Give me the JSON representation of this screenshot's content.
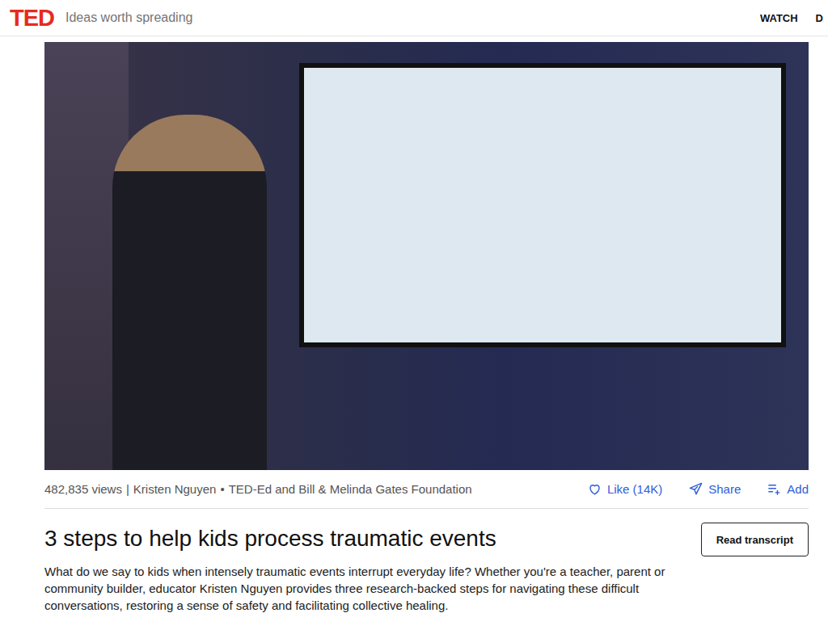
{
  "header": {
    "logo": "TED",
    "tagline": "Ideas worth spreading",
    "nav": [
      "WATCH",
      "D"
    ]
  },
  "meta": {
    "views": "482,835 views",
    "separator": "|",
    "speaker": "Kristen Nguyen",
    "bullet": "•",
    "event": "TED-Ed and Bill & Melinda Gates Foundation"
  },
  "actions": [
    {
      "label": "Like (14K)",
      "kind": "like"
    },
    {
      "label": "Share",
      "kind": "share"
    },
    {
      "label": "Add",
      "kind": "add"
    }
  ],
  "title": "3 steps to help kids process traumatic events",
  "transcript_button": "Read transcript",
  "description": "What do we say to kids when intensely traumatic events interrupt everyday life? Whether you're a teacher, parent or community builder, educator Kristen Nguyen provides three research-backed steps for navigating these difficult conversations, restoring a sense of safety and facilitating collective healing."
}
